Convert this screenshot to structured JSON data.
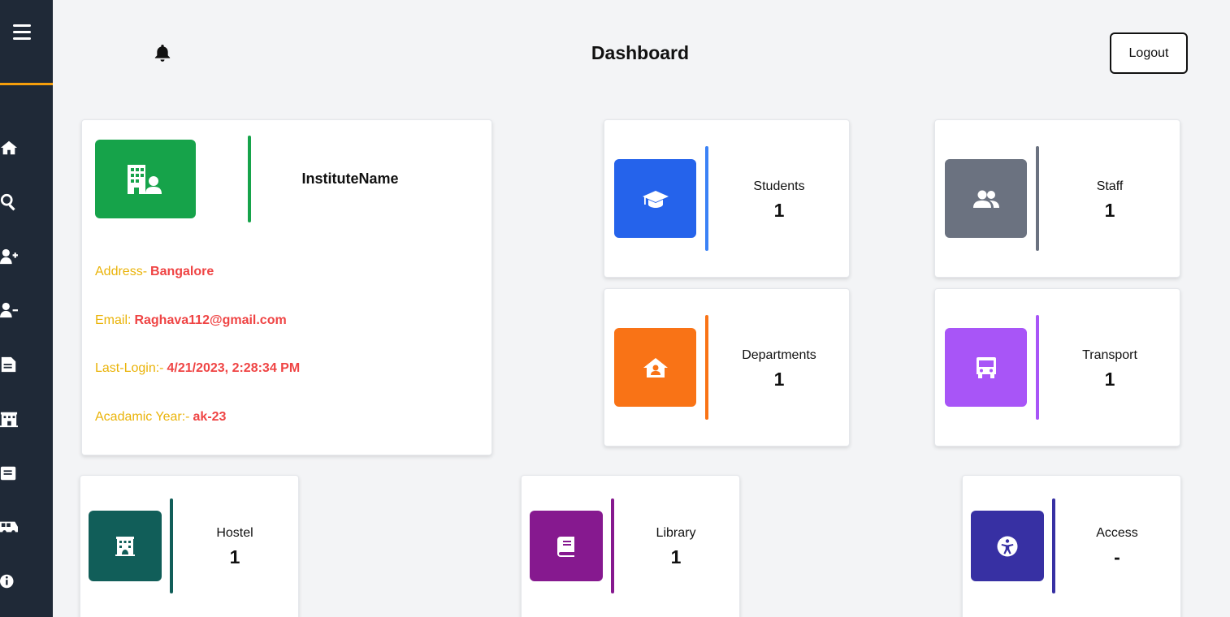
{
  "header": {
    "title": "Dashboard",
    "logout_label": "Logout"
  },
  "sidebar": {
    "items": [
      {
        "name": "home-icon"
      },
      {
        "name": "search-icon"
      },
      {
        "name": "user-plus-icon"
      },
      {
        "name": "user-minus-icon"
      },
      {
        "name": "document-icon"
      },
      {
        "name": "building-icon"
      },
      {
        "name": "book-icon"
      },
      {
        "name": "bus-icon"
      },
      {
        "name": "info-icon"
      }
    ],
    "accent_color": "#f59e0b"
  },
  "institute": {
    "name": "InstituteName",
    "address_label": "Address-",
    "address": "Bangalore",
    "email_label": "Email:",
    "email": "Raghava112@gmail.com",
    "last_login_label": "Last-Login:-",
    "last_login": "4/21/2023, 2:28:34 PM",
    "year_label": "Acadamic Year:-",
    "year": "ak-23",
    "color": "#16a34a"
  },
  "stats": {
    "students": {
      "label": "Students",
      "value": "1",
      "color": "#2563eb",
      "icon": "graduation-cap-icon"
    },
    "staff": {
      "label": "Staff",
      "value": "1",
      "color": "#6b7280",
      "icon": "users-icon"
    },
    "departments": {
      "label": "Departments",
      "value": "1",
      "color": "#f97316",
      "icon": "house-user-icon"
    },
    "transport": {
      "label": "Transport",
      "value": "1",
      "color": "#a855f7",
      "icon": "bus-icon"
    },
    "hostel": {
      "label": "Hostel",
      "value": "1",
      "color": "#115e59",
      "icon": "hotel-icon"
    },
    "library": {
      "label": "Library",
      "value": "1",
      "color": "#86198f",
      "icon": "book-icon"
    },
    "access": {
      "label": "Access",
      "value": "-",
      "color": "#3730a3",
      "icon": "accessibility-icon"
    }
  }
}
